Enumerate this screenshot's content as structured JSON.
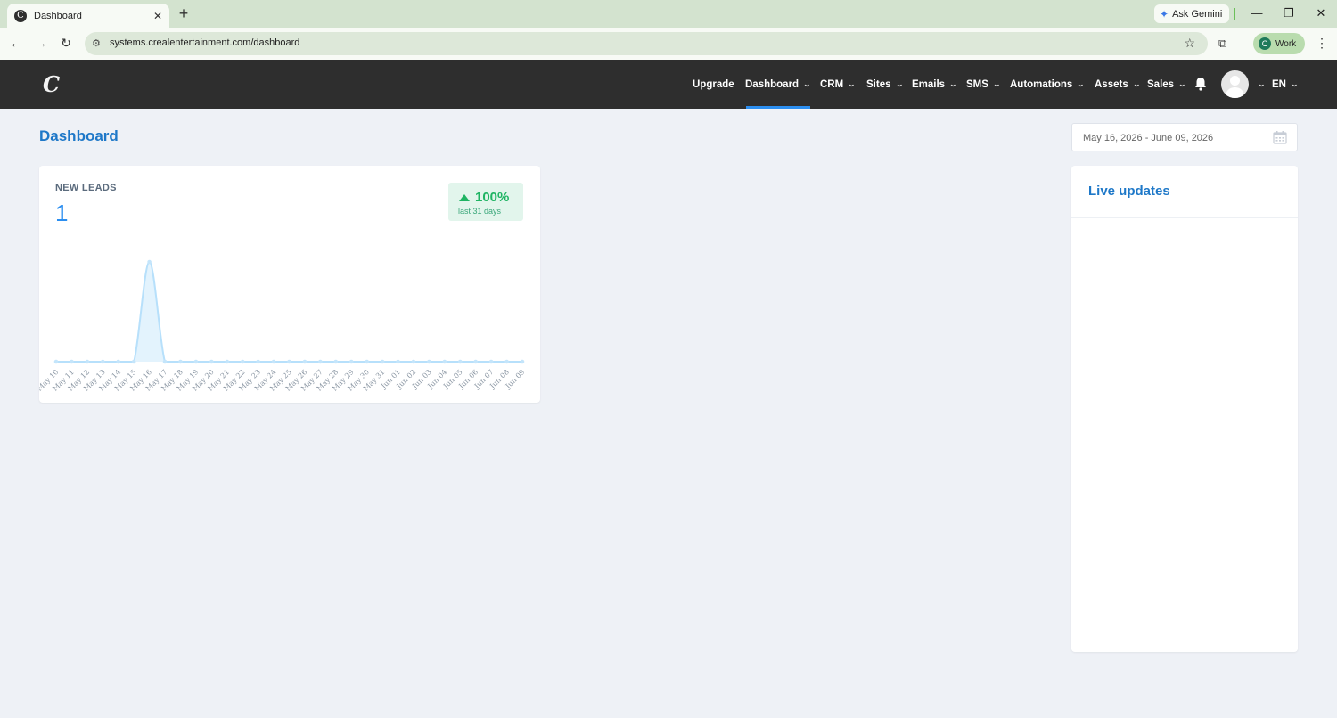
{
  "browser": {
    "tab_title": "Dashboard",
    "tab_close": "✕",
    "new_tab": "+",
    "gemini_label": "Ask Gemini",
    "url": "systems.crealentertainment.com/dashboard",
    "profile_initial": "C",
    "profile_label": "Work",
    "win_minimize": "—",
    "win_restore": "❐",
    "win_close": "✕"
  },
  "app": {
    "logo": "C",
    "nav": [
      "Upgrade",
      "Dashboard",
      "CRM",
      "Sites",
      "Emails",
      "SMS",
      "Automations",
      "Assets",
      "Sales"
    ],
    "active_nav": "Dashboard",
    "language": "EN",
    "brand_color": "#1e78c8",
    "nav_bg": "#2e2e2e",
    "accent": "#2b8ef0"
  },
  "page": {
    "title": "Dashboard",
    "date_range": "May 16, 2026 - June 09, 2026"
  },
  "leads_card": {
    "label": "NEW LEADS",
    "value": "1",
    "trend_pct": "100%",
    "trend_sub": "last 31 days",
    "trend_color": "#1fb463"
  },
  "live_updates": {
    "title": "Live updates"
  },
  "chart_data": {
    "type": "area",
    "title": "",
    "xlabel": "",
    "ylabel": "",
    "categories": [
      "May 10",
      "May 11",
      "May 12",
      "May 13",
      "May 14",
      "May 15",
      "May 16",
      "May 17",
      "May 18",
      "May 19",
      "May 20",
      "May 21",
      "May 22",
      "May 23",
      "May 24",
      "May 25",
      "May 26",
      "May 27",
      "May 28",
      "May 29",
      "May 30",
      "May 31",
      "Jun 01",
      "Jun 02",
      "Jun 03",
      "Jun 04",
      "Jun 05",
      "Jun 06",
      "Jun 07",
      "Jun 08",
      "Jun 09"
    ],
    "values": [
      0,
      0,
      0,
      0,
      0,
      0,
      1,
      0,
      0,
      0,
      0,
      0,
      0,
      0,
      0,
      0,
      0,
      0,
      0,
      0,
      0,
      0,
      0,
      0,
      0,
      0,
      0,
      0,
      0,
      0,
      0
    ],
    "ylim": [
      0,
      1
    ],
    "grid": false,
    "legend": "none"
  }
}
